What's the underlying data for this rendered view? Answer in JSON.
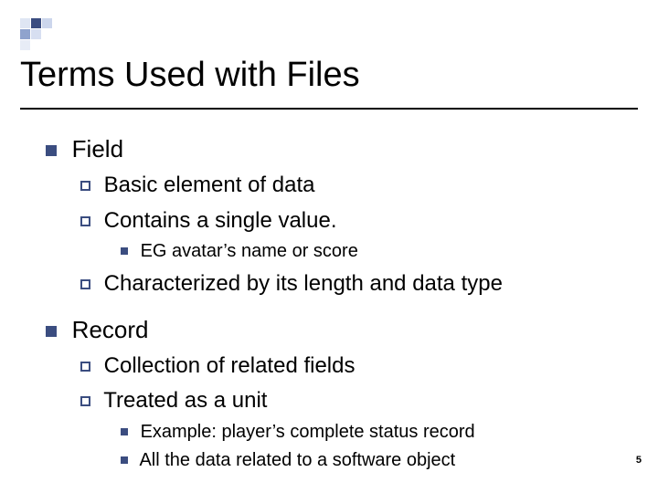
{
  "slide": {
    "title": "Terms Used with Files",
    "page_number": "5"
  },
  "items": [
    {
      "label": "Field",
      "sub": [
        {
          "text": "Basic element of data"
        },
        {
          "text": "Contains a single value.",
          "sub": [
            {
              "text": "EG avatar’s name or score"
            }
          ]
        },
        {
          "text": "Characterized by its length and data type"
        }
      ]
    },
    {
      "label": "Record",
      "sub": [
        {
          "text": "Collection of related fields"
        },
        {
          "text": "Treated as a unit",
          "sub": [
            {
              "text": "Example: player’s complete status record"
            },
            {
              "text": "All the data related to a software object"
            }
          ]
        }
      ]
    }
  ]
}
